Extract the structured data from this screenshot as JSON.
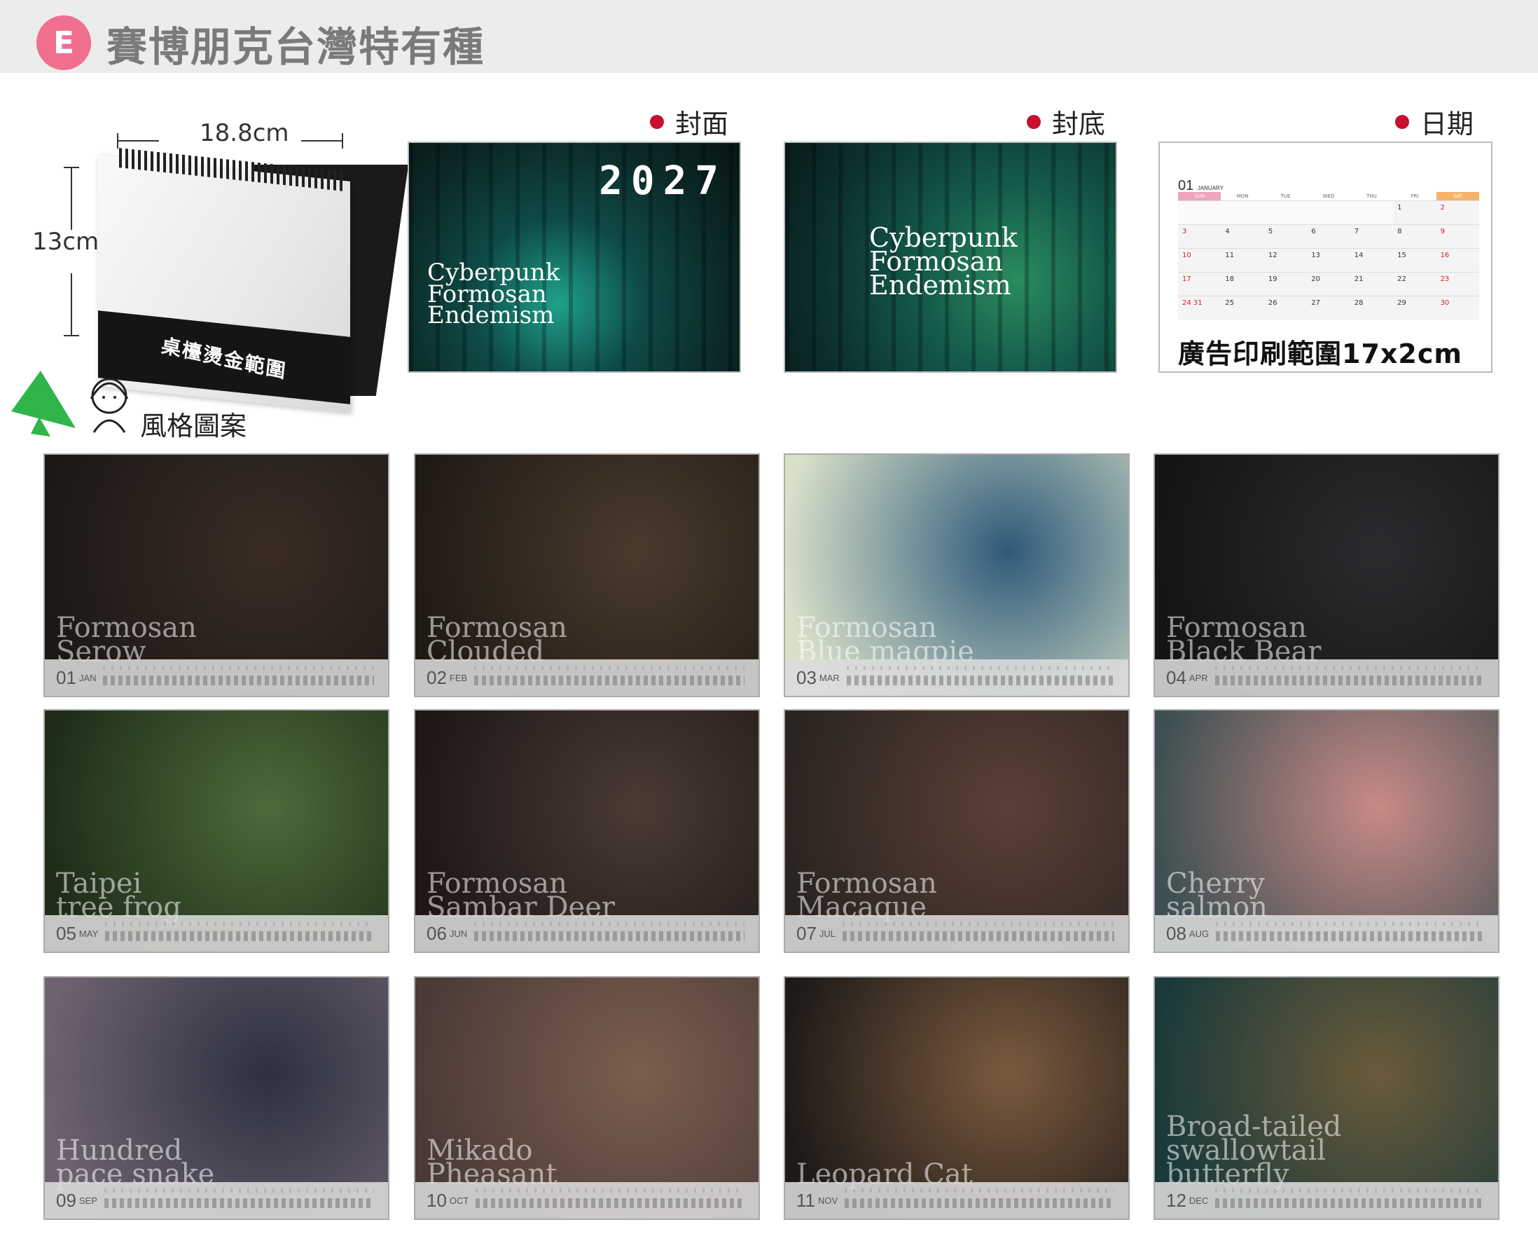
{
  "header": {
    "badge": "E",
    "title": "賽博朋克台灣特有種"
  },
  "desk_calendar": {
    "width_label": "18.8cm",
    "height_label": "13cm",
    "base_label": "桌檯燙金範圍"
  },
  "style_label": "風格圖案",
  "sections": {
    "cover_front": "封面",
    "cover_back": "封底",
    "date": "日期"
  },
  "cover_front": {
    "year": "2027",
    "title_lines": [
      "Cyberpunk",
      "Formosan",
      "Endemism"
    ]
  },
  "cover_back": {
    "title_lines": [
      "Cyberpunk",
      "Formosan",
      "Endemism"
    ]
  },
  "date_sample": {
    "month_number": "01",
    "month_name": "JANUARY",
    "weekdays": [
      "SUN",
      "MON",
      "TUE",
      "WED",
      "THU",
      "FRI",
      "SAT"
    ],
    "weeks": [
      [
        "",
        "",
        "",
        "",
        "",
        "1",
        "2"
      ],
      [
        "3",
        "4",
        "5",
        "6",
        "7",
        "8",
        "9"
      ],
      [
        "10",
        "11",
        "12",
        "13",
        "14",
        "15",
        "16"
      ],
      [
        "17",
        "18",
        "19",
        "20",
        "21",
        "22",
        "23"
      ],
      [
        "24 31",
        "25",
        "26",
        "27",
        "28",
        "29",
        "30"
      ]
    ],
    "ad_text": "廣告印刷範圍17x2cm"
  },
  "months": [
    {
      "num": "01",
      "name": "JAN",
      "title": [
        "Formosan",
        "Serow"
      ],
      "bg": [
        "#3a2c24",
        "#1c1816"
      ]
    },
    {
      "num": "02",
      "name": "FEB",
      "title": [
        "Formosan",
        "Clouded"
      ],
      "bg": [
        "#4a3a2c",
        "#201a15"
      ]
    },
    {
      "num": "03",
      "name": "MAR",
      "title": [
        "Formosan",
        "Blue magpie"
      ],
      "bg": [
        "#2e5a7a",
        "#d8e0c8"
      ]
    },
    {
      "num": "04",
      "name": "APR",
      "title": [
        "Formosan",
        "Black Bear"
      ],
      "bg": [
        "#2b2b2e",
        "#141416"
      ]
    },
    {
      "num": "05",
      "name": "MAY",
      "title": [
        "Taipei",
        "tree frog"
      ],
      "bg": [
        "#4b6a3a",
        "#1e2c18"
      ]
    },
    {
      "num": "06",
      "name": "JUN",
      "title": [
        "Formosan",
        "Sambar Deer"
      ],
      "bg": [
        "#4a3a34",
        "#1e1716"
      ]
    },
    {
      "num": "07",
      "name": "JUL",
      "title": [
        "Formosan",
        "Macaque"
      ],
      "bg": [
        "#5a4036",
        "#2a2420"
      ]
    },
    {
      "num": "08",
      "name": "AUG",
      "title": [
        "Cherry",
        "salmon"
      ],
      "bg": [
        "#c88a86",
        "#3e5052"
      ]
    },
    {
      "num": "09",
      "name": "SEP",
      "title": [
        "Hundred",
        "pace snake"
      ],
      "bg": [
        "#2c3040",
        "#6e6270"
      ]
    },
    {
      "num": "10",
      "name": "OCT",
      "title": [
        "Mikado",
        "Pheasant"
      ],
      "bg": [
        "#7a5e4e",
        "#4a3a36"
      ]
    },
    {
      "num": "11",
      "name": "NOV",
      "title": [
        "Leopard Cat"
      ],
      "bg": [
        "#7a5a3e",
        "#1e1a18"
      ]
    },
    {
      "num": "12",
      "name": "DEC",
      "title": [
        "Broad-tailed",
        "swallowtail",
        "butterfly"
      ],
      "bg": [
        "#6a5a3a",
        "#1a3a3a"
      ]
    }
  ]
}
